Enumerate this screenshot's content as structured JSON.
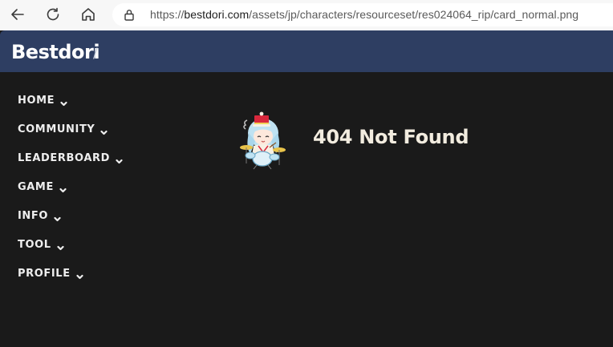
{
  "browser": {
    "url_scheme": "https://",
    "url_host": "bestdori.com",
    "url_path": "/assets/jp/characters/resourceset/res024064_rip/card_normal.png"
  },
  "header": {
    "brand": "Bestdori",
    "separator": "/",
    "color": "#2e3e62"
  },
  "sidebar": {
    "items": [
      {
        "label": "HOME"
      },
      {
        "label": "COMMUNITY"
      },
      {
        "label": "LEADERBOARD"
      },
      {
        "label": "GAME"
      },
      {
        "label": "INFO"
      },
      {
        "label": "TOOL"
      },
      {
        "label": "PROFILE"
      }
    ]
  },
  "main": {
    "message": "404 Not Found",
    "mascot_icon": "drummer-girl-chibi-icon"
  },
  "colors": {
    "background": "#1a1a1a",
    "text": "#f2ecdf"
  }
}
